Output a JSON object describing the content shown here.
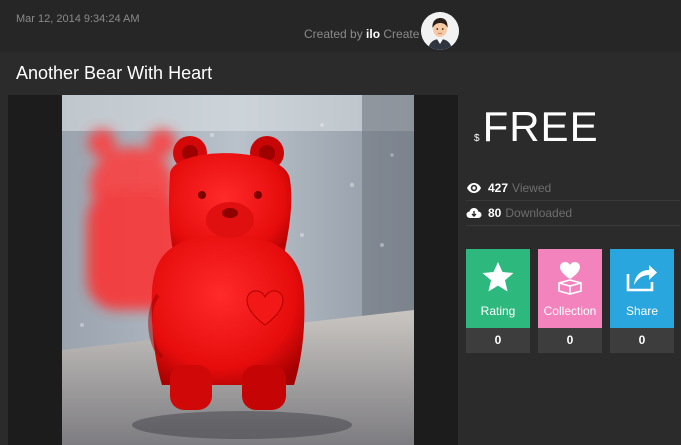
{
  "header": {
    "date": "Mar 12, 2014 9:34:24 AM",
    "created_by_prefix": "Created by",
    "creator_name": "ilo",
    "created_by_suffix": "Create",
    "avatar_icon": "user-avatar-icon"
  },
  "model": {
    "title": "Another Bear With Heart",
    "image": "red-3d-printed-bear-photo"
  },
  "price": {
    "currency": "$",
    "value": "FREE"
  },
  "stats": {
    "views_count": "427",
    "views_label": "Viewed",
    "downloads_count": "80",
    "downloads_label": "Downloaded"
  },
  "actions": [
    {
      "label": "Rating",
      "count": "0",
      "icon": "star-icon",
      "color": "#2db87d"
    },
    {
      "label": "Collection",
      "count": "0",
      "icon": "heart-box-icon",
      "color": "#f283bd"
    },
    {
      "label": "Share",
      "count": "0",
      "icon": "share-icon",
      "color": "#29a6dd"
    }
  ],
  "colors": {
    "background": "#2b2b2b",
    "header_bg": "#262626",
    "muted_text": "#8a8a8a"
  }
}
